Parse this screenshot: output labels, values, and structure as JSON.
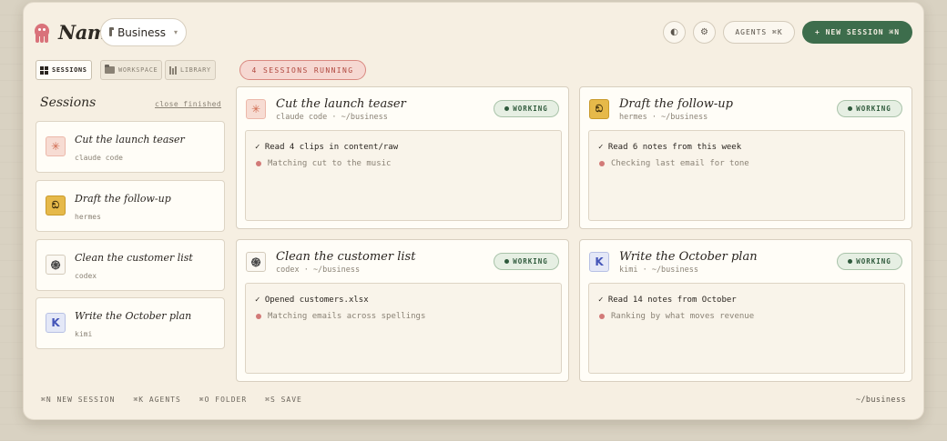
{
  "app": {
    "brand": "Nami",
    "workspace": "Business"
  },
  "header": {
    "theme_icon": "◐",
    "settings_icon": "⚙",
    "agents_label": "AGENTS ⌘K",
    "new_session_label": "+ NEW SESSION ⌘N"
  },
  "tabs": [
    {
      "label": "SESSIONS",
      "active": true
    },
    {
      "label": "WORKSPACE",
      "active": false
    },
    {
      "label": "LIBRARY",
      "active": false
    }
  ],
  "running_badge": "4 SESSIONS RUNNING",
  "sidebar": {
    "title": "Sessions",
    "close_finished": "close finished",
    "items": [
      {
        "title": "Cut the launch teaser",
        "agent": "claude code",
        "avatar": "claude"
      },
      {
        "title": "Draft the follow-up",
        "agent": "hermes",
        "avatar": "hermes"
      },
      {
        "title": "Clean the customer list",
        "agent": "codex",
        "avatar": "codex"
      },
      {
        "title": "Write the October plan",
        "agent": "kimi",
        "avatar": "kimi"
      }
    ]
  },
  "panels": [
    {
      "title": "Cut the launch teaser",
      "subtitle": "claude code · ~/business",
      "status": "WORKING",
      "done": "✓ Read 4 clips in content/raw",
      "pending": "Matching cut to the music"
    },
    {
      "title": "Draft the follow-up",
      "subtitle": "hermes · ~/business",
      "status": "WORKING",
      "done": "✓ Read 6 notes from this week",
      "pending": "Checking last email for tone"
    },
    {
      "title": "Clean the customer list",
      "subtitle": "codex · ~/business",
      "status": "WORKING",
      "done": "✓ Opened customers.xlsx",
      "pending": "Matching emails across spellings"
    },
    {
      "title": "Write the October plan",
      "subtitle": "kimi · ~/business",
      "status": "WORKING",
      "done": "✓ Read 14 notes from October",
      "pending": "Ranking by what moves revenue"
    }
  ],
  "avatar_glyphs": {
    "claude": "✳",
    "hermes": "ඞ",
    "codex": "֍",
    "kimi": "K"
  },
  "footer": {
    "shortcuts": [
      "⌘N NEW SESSION",
      "⌘K AGENTS",
      "⌘O FOLDER",
      "⌘S SAVE"
    ],
    "path": "~/business"
  },
  "colors": {
    "accent_green": "#3d6d4c",
    "running_red": "#b0473e",
    "background": "#f6efe2"
  }
}
